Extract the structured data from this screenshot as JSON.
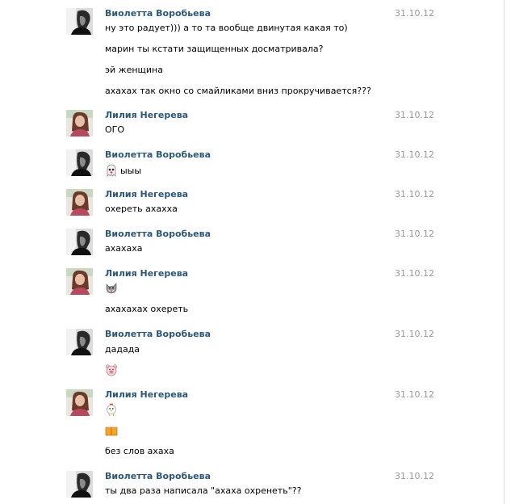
{
  "conversation": {
    "messages": [
      {
        "author": "Виолетта Воробьева",
        "date": "31.10.12",
        "lines": [
          "ну это радует))) а то та вообще двинутая какая то)",
          "марин ты кстати защищенных досматривала?",
          "эй женщина",
          "ахахах так окно со смайликами вниз прокручивается???"
        ]
      },
      {
        "author": "Лилия Негерева",
        "date": "31.10.12",
        "lines": [
          "ОГО"
        ]
      },
      {
        "author": "Виолетта Воробьева",
        "date": "31.10.12",
        "lines": [
          "ыыы"
        ],
        "emoji": "ghost-emoji"
      },
      {
        "author": "Лилия Негерева",
        "date": "31.10.12",
        "lines": [
          "охереть ахахха"
        ]
      },
      {
        "author": "Виолетта Воробьева",
        "date": "31.10.12",
        "lines": [
          "ахахаха"
        ]
      },
      {
        "author": "Лилия Негерева",
        "date": "31.10.12",
        "lines": [
          "ахахахах охереть"
        ],
        "emoji": "wolf-emoji"
      },
      {
        "author": "Виолетта Воробьева",
        "date": "31.10.12",
        "lines": [
          "дадада"
        ],
        "emoji": "pig-emoji"
      },
      {
        "author": "Лилия Негерева",
        "date": "31.10.12",
        "lines": [
          "без слов ахаха"
        ],
        "emojis": [
          "chicken-emoji",
          "beer-emoji"
        ]
      },
      {
        "author": "Виолетта Воробьева",
        "date": "31.10.12",
        "lines": [
          "ты два раза написала \"ахаха охренеть\"??"
        ]
      }
    ]
  }
}
